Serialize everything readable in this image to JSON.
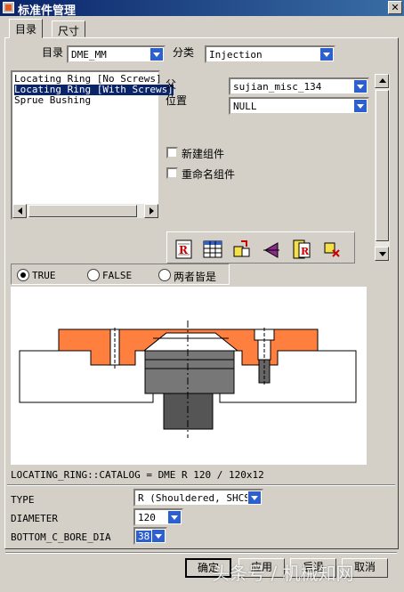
{
  "window": {
    "title": "标准件管理"
  },
  "tabs": [
    {
      "label": "目录"
    },
    {
      "label": "尺寸"
    }
  ],
  "catalog": {
    "label": "目录",
    "value": "DME_MM"
  },
  "category": {
    "label": "分类",
    "value": "Injection"
  },
  "component_list": {
    "items": [
      {
        "label": "Locating Ring [No Screws]",
        "selected": false
      },
      {
        "label": "Locating Ring [With Screws]",
        "selected": true
      },
      {
        "label": "Sprue Bushing",
        "selected": false
      }
    ]
  },
  "parent": {
    "label": "父",
    "value": "sujian_misc_134"
  },
  "position": {
    "label": "位置",
    "value": "NULL"
  },
  "options": {
    "new_component": "新建组件",
    "rename_component": "重命名组件"
  },
  "toolbar_icons": [
    "report-icon",
    "spreadsheet-icon",
    "reposition-icon",
    "flip-icon",
    "rename-report-icon",
    "delete-component-icon"
  ],
  "radio": {
    "options": [
      "TRUE",
      "FALSE",
      "两者皆是"
    ],
    "selected": "TRUE"
  },
  "catalog_line": "LOCATING_RING::CATALOG = DME R 120  / 120x12",
  "params": [
    {
      "name": "TYPE",
      "value": "R (Shouldered, SHCS)"
    },
    {
      "name": "DIAMETER",
      "value": "120"
    },
    {
      "name": "BOTTOM_C_BORE_DIA",
      "value": "38"
    }
  ],
  "buttons": {
    "ok": "确定",
    "apply": "应用",
    "back": "后退",
    "cancel": "取消"
  },
  "watermark": "头条号 / 机械知网",
  "colors": {
    "accent": "#2c5fcf",
    "title_bar": "#0a246a",
    "ring_orange": "#ff7f3f",
    "steel_gray": "#777777"
  }
}
